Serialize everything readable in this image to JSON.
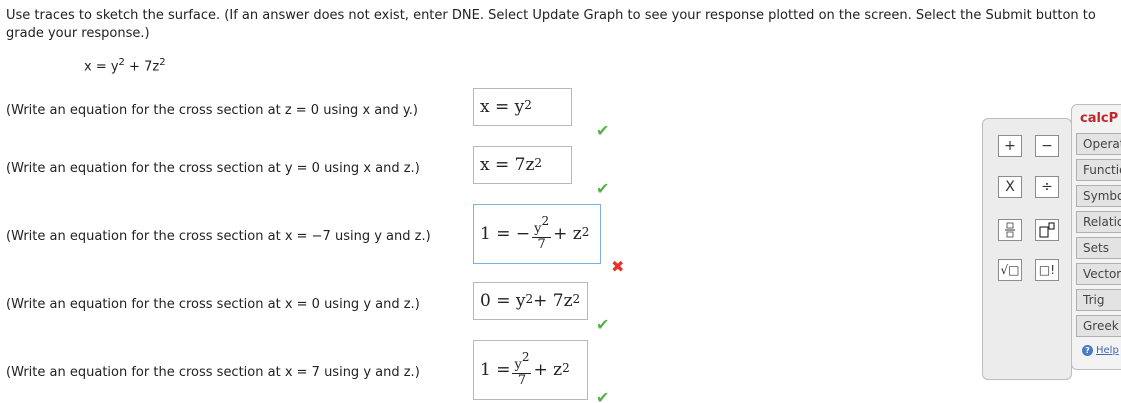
{
  "instructions": "Use traces to sketch the surface. (If an answer does not exist, enter DNE. Select Update Graph to see your response plotted on the screen. Select the Submit button to grade your response.)",
  "given_equation": {
    "lhs": "x = y",
    "mid": " + 7z",
    "exp": "2"
  },
  "questions": [
    {
      "prompt": "(Write an equation for the cross section at z = 0 using x and y.)",
      "status": "correct"
    },
    {
      "prompt": "(Write an equation for the cross section at y = 0 using x and z.)",
      "status": "correct"
    },
    {
      "prompt": "(Write an equation for the cross section at x = −7 using y and z.)",
      "status": "incorrect"
    },
    {
      "prompt": "(Write an equation for the cross section at x = 0 using y and z.)",
      "status": "correct"
    },
    {
      "prompt": "(Write an equation for the cross section at x = 7 using y and z.)",
      "status": "correct"
    }
  ],
  "answers": {
    "a1": {
      "lhs": "x = y",
      "exp": "2"
    },
    "a2": {
      "lhs": "x = 7z",
      "exp": "2"
    },
    "a3": {
      "lhs": "1 = −",
      "num": "y",
      "num_exp": "2",
      "den": "7",
      "rest": "+ z",
      "rest_exp": "2"
    },
    "a4": {
      "lhs": "0 = y",
      "exp1": "2",
      "mid": " + 7z",
      "exp2": "2"
    },
    "a5": {
      "lhs": "1 = ",
      "num": "y",
      "num_exp": "2",
      "den": "7",
      "rest": "+ z",
      "rest_exp": "2"
    }
  },
  "marks": {
    "correct": "✔",
    "incorrect": "✖"
  },
  "keypad": {
    "plus": "+",
    "minus": "−",
    "times": "X",
    "divide": "÷",
    "sqrt": "√□",
    "factorial": "□!"
  },
  "calc_panel": {
    "title": "calcP",
    "tabs": [
      "Operat",
      "Functio",
      "Symbo",
      "Relatio",
      "Sets",
      "Vector",
      "Trig",
      "Greek"
    ],
    "help": "Help"
  },
  "colors": {
    "correct": "#5bb04e",
    "incorrect": "#e2352e",
    "calc_title": "#c0272d"
  }
}
